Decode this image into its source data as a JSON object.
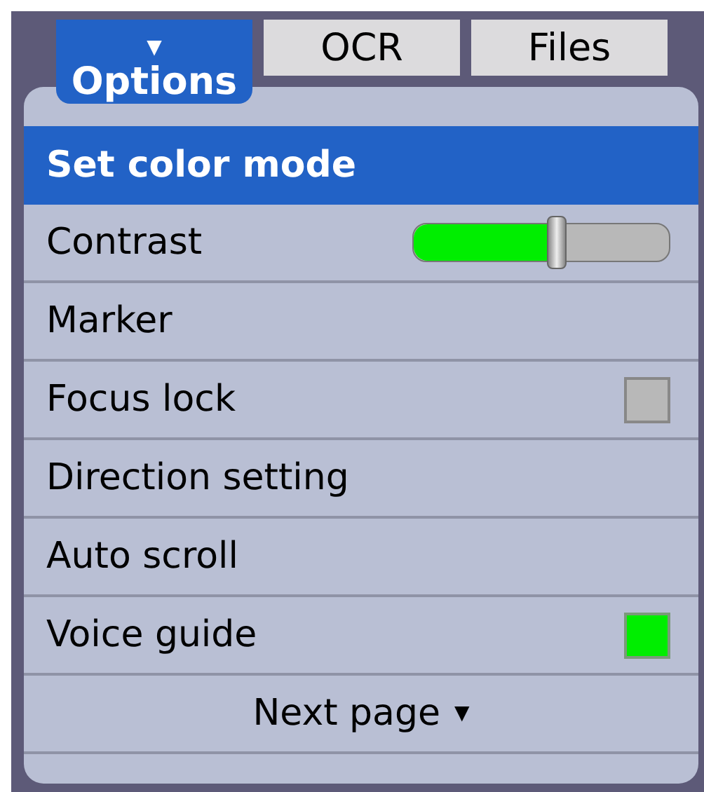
{
  "tabs": [
    {
      "label": "Options",
      "marker": "▼",
      "selected": true
    },
    {
      "label": "OCR",
      "selected": false
    },
    {
      "label": "Files",
      "selected": false
    }
  ],
  "menu": [
    {
      "kind": "plain",
      "label": "Set color mode",
      "selected": true
    },
    {
      "kind": "slider",
      "label": "Contrast",
      "selected": false,
      "level": 0.56
    },
    {
      "kind": "plain",
      "label": "Marker",
      "selected": false
    },
    {
      "kind": "checkbox",
      "label": "Focus lock",
      "selected": false,
      "checked": false
    },
    {
      "kind": "plain",
      "label": "Direction setting",
      "selected": false
    },
    {
      "kind": "plain",
      "label": "Auto scroll",
      "selected": false
    },
    {
      "kind": "checkbox",
      "label": "Voice guide",
      "selected": false,
      "checked": true
    }
  ],
  "next_page": {
    "label": "Next page",
    "arrow": "▼"
  }
}
